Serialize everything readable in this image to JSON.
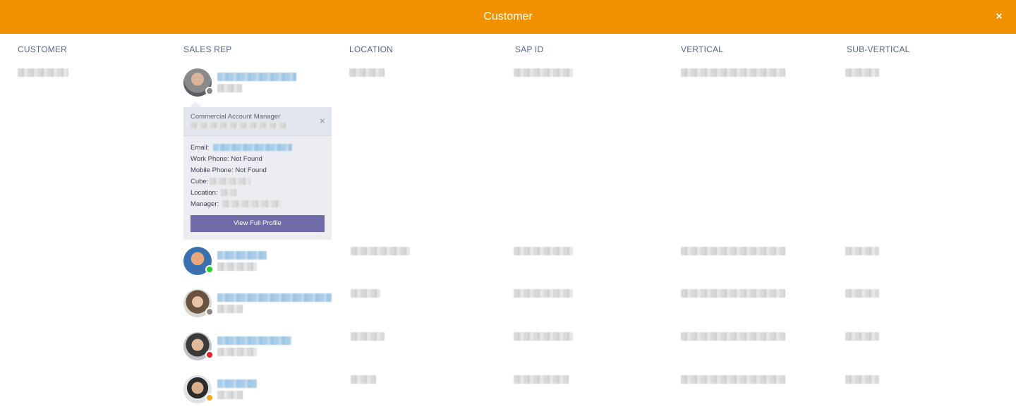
{
  "header": {
    "title": "Customer",
    "close_label": "×"
  },
  "columns": [
    "CUSTOMER",
    "SALES REP",
    "LOCATION",
    "SAP ID",
    "VERTICAL",
    "SUB-VERTICAL"
  ],
  "popover": {
    "role": "Commercial Account Manager",
    "close_label": "×",
    "email_label": "Email:",
    "work_phone": "Work Phone: Not Found",
    "mobile_phone": "Mobile Phone: Not Found",
    "cube_label": "Cube:",
    "location_label": "Location:",
    "manager_label": "Manager:",
    "button_label": "View Full Profile"
  },
  "rows": [
    {
      "status": "offline",
      "status_color": "#888888"
    },
    {
      "status": "available",
      "status_color": "#2ecc2e"
    },
    {
      "status": "offline",
      "status_color": "#888888"
    },
    {
      "status": "busy",
      "status_color": "#e8222b"
    },
    {
      "status": "away",
      "status_color": "#f5a623"
    }
  ],
  "colors": {
    "header": "#f29100",
    "button": "#6f6aa8",
    "column_header": "#54698d"
  }
}
